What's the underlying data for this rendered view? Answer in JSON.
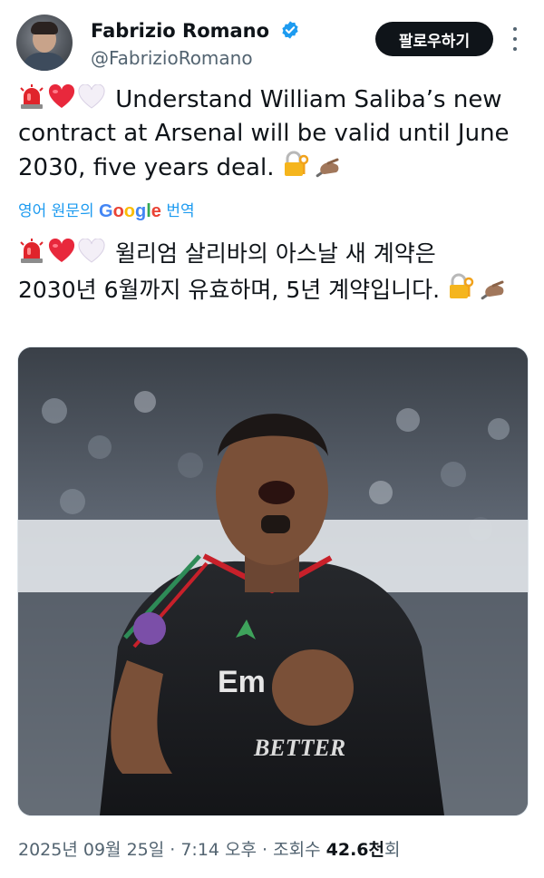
{
  "header": {
    "display_name": "Fabrizio Romano",
    "handle": "@FabrizioRomano",
    "follow_label": "팔로우하기"
  },
  "tweet": {
    "text_line1": "Understand William Saliba’s new",
    "text_line2": "contract at Arsenal will be valid until June",
    "text_line3": "2030, five years deal.",
    "translate_prefix": "영어 원문의",
    "translate_suffix": "번역",
    "translated_line1": "윌리엄 살리바의 아스날 새 계약은",
    "translated_line2": "2030년 6월까지 유효하며, 5년 계약입니다."
  },
  "google_logo": [
    "G",
    "o",
    "o",
    "g",
    "l",
    "e"
  ],
  "meta": {
    "date": "2025년 09월 25일 · 7:14 오후 · 조회수 ",
    "views": "42.6천",
    "views_suffix": "회"
  },
  "photo_sponsor_text": "Em",
  "photo_shirt_text": "BETTER",
  "icons": [
    "siren-emoji",
    "red-heart-emoji",
    "white-heart-emoji",
    "locked-with-key-emoji",
    "writing-hand-emoji",
    "verified-badge-icon",
    "more-options-icon"
  ],
  "colors": {
    "accent": "#1d9bf0",
    "text": "#0f1419",
    "muted": "#536471",
    "button": "#0f1419"
  }
}
